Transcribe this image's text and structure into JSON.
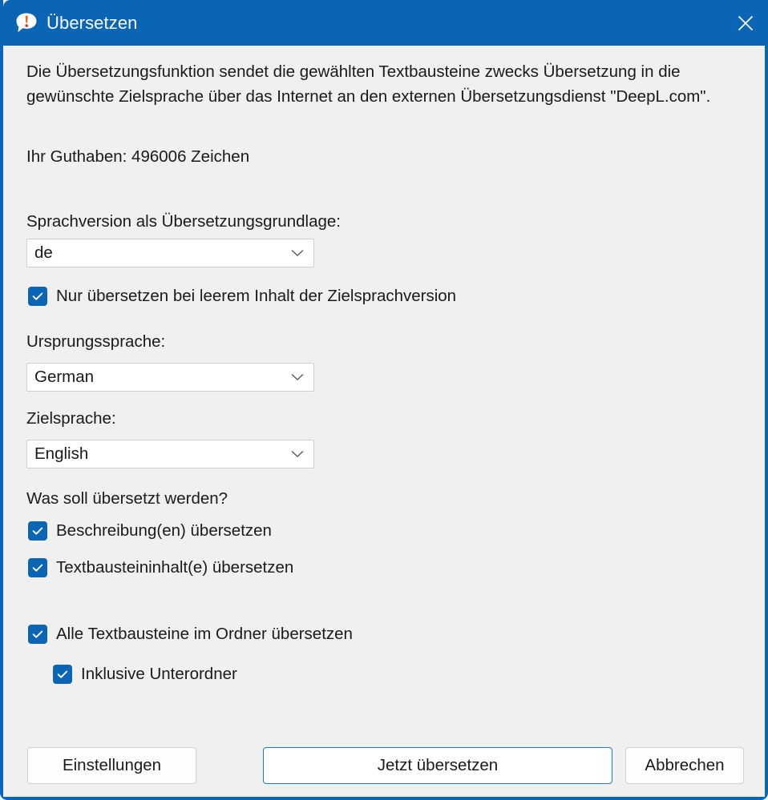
{
  "window": {
    "title": "Übersetzen",
    "icon": "speech-bubble-exclamation-icon",
    "close_icon": "close-icon",
    "accent_color": "#0a66b5",
    "background_color": "#f0f0f0"
  },
  "body": {
    "description": "Die Übersetzungsfunktion sendet die gewählten Textbausteine zwecks Übersetzung in die gewünschte Zielsprache über das Internet an den externen Übersetzungsdienst \"DeepL.com\".",
    "credit_label": "Ihr Guthaben: 496006 Zeichen"
  },
  "fields": {
    "base_language": {
      "label": "Sprachversion als Übersetzungsgrundlage:",
      "value": "de",
      "chevron_icon": "chevron-down-icon"
    },
    "source_language": {
      "label": "Ursprungssprache:",
      "value": "German",
      "chevron_icon": "chevron-down-icon"
    },
    "target_language": {
      "label": "Zielsprache:",
      "value": "English",
      "chevron_icon": "chevron-down-icon"
    }
  },
  "options": {
    "only_empty": {
      "label": "Nur übersetzen bei leerem Inhalt der Zielsprachversion",
      "checked": true
    },
    "what_to_translate_label": "Was soll übersetzt werden?",
    "translate_descriptions": {
      "label": "Beschreibung(en) übersetzen",
      "checked": true
    },
    "translate_contents": {
      "label": "Textbausteininhalt(e) übersetzen",
      "checked": true
    },
    "all_in_folder": {
      "label": "Alle Textbausteine im Ordner übersetzen",
      "checked": true
    },
    "include_subfolders": {
      "label": "Inklusive Unterordner",
      "checked": true
    }
  },
  "buttons": {
    "settings": "Einstellungen",
    "translate_now": "Jetzt übersetzen",
    "cancel": "Abbrechen"
  }
}
